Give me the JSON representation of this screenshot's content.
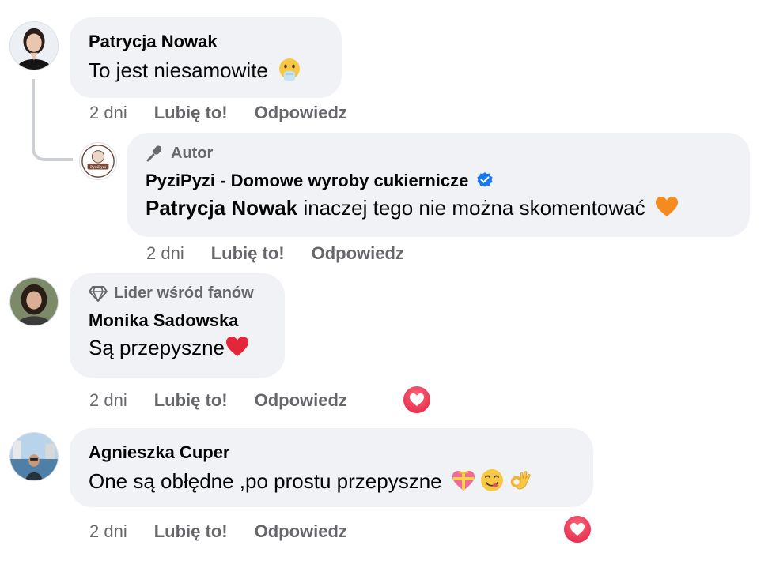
{
  "comments": [
    {
      "author": "Patrycja Nowak",
      "text": "To jest niesamowite",
      "emoji": "face-with-hand-over-mouth-emoji",
      "time": "2 dni",
      "like": "Lubię to!",
      "reply": "Odpowiedz"
    },
    {
      "badge": "Autor",
      "author": "PyziPyzi - Domowe wyroby cukiernicze",
      "verified_icon": "verified-badge-icon",
      "mention": "Patrycja Nowak",
      "text": " inaczej tego nie można skomentować",
      "emoji": "orange-heart-emoji",
      "time": "2 dni",
      "like": "Lubię to!",
      "reply": "Odpowiedz"
    },
    {
      "badge": "Lider wśród fanów",
      "author": "Monika Sadowska",
      "text": "Są przepyszne",
      "emoji": "red-heart-emoji",
      "time": "2 dni",
      "like": "Lubię to!",
      "reply": "Odpowiedz",
      "reaction": "love-reaction-icon"
    },
    {
      "author": "Agnieszka Cuper",
      "text": "One są obłędne ,po prostu przepyszne",
      "emojis": [
        "gift-heart-emoji",
        "yum-face-emoji",
        "ok-hand-emoji"
      ],
      "time": "2 dni",
      "like": "Lubię to!",
      "reply": "Odpowiedz",
      "reaction": "love-reaction-icon"
    }
  ],
  "colors": {
    "bubble": "#f0f2f5",
    "secondary_text": "#65676b",
    "verified": "#1877f2",
    "love": "#e41e3f"
  }
}
